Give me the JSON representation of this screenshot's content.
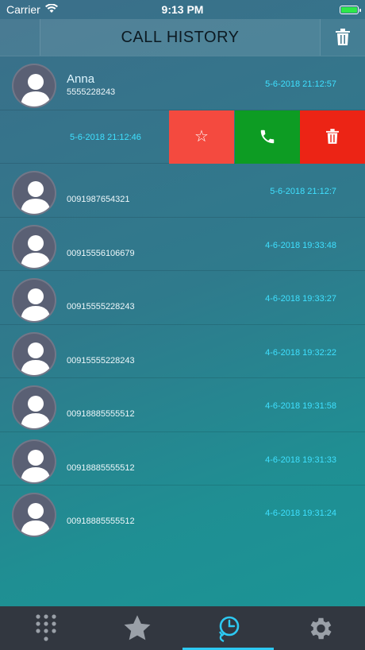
{
  "status_bar": {
    "carrier": "Carrier",
    "time": "9:13 PM"
  },
  "header": {
    "title": "CALL HISTORY"
  },
  "swiped_row": {
    "date": "5-6-2018 21:12:46",
    "actions": [
      "favorite",
      "call",
      "delete"
    ]
  },
  "calls": [
    {
      "name": "Anna",
      "number": "5555228243",
      "date": "5-6-2018 21:12:57"
    },
    {
      "name": "",
      "number": "0091987654321",
      "date": "5-6-2018 21:12:7"
    },
    {
      "name": "",
      "number": "00915556106679",
      "date": "4-6-2018 19:33:48"
    },
    {
      "name": "",
      "number": "00915555228243",
      "date": "4-6-2018 19:33:27"
    },
    {
      "name": "",
      "number": "00915555228243",
      "date": "4-6-2018 19:32:22"
    },
    {
      "name": "",
      "number": "00918885555512",
      "date": "4-6-2018 19:31:58"
    },
    {
      "name": "",
      "number": "00918885555512",
      "date": "4-6-2018 19:31:33"
    },
    {
      "name": "",
      "number": "00918885555512",
      "date": "4-6-2018 19:31:24"
    }
  ],
  "tabs": [
    {
      "id": "keypad",
      "icon": "keypad-icon",
      "active": false
    },
    {
      "id": "favorites",
      "icon": "star-icon",
      "active": false
    },
    {
      "id": "history",
      "icon": "history-icon",
      "active": true
    },
    {
      "id": "settings",
      "icon": "gear-icon",
      "active": false
    }
  ],
  "colors": {
    "accent": "#2dc9f2",
    "date_text": "#3fe0ff",
    "favorite_action": "#f44a3f",
    "call_action": "#0d9c23",
    "delete_action": "#ec2415",
    "tab_bar": "#323740"
  }
}
